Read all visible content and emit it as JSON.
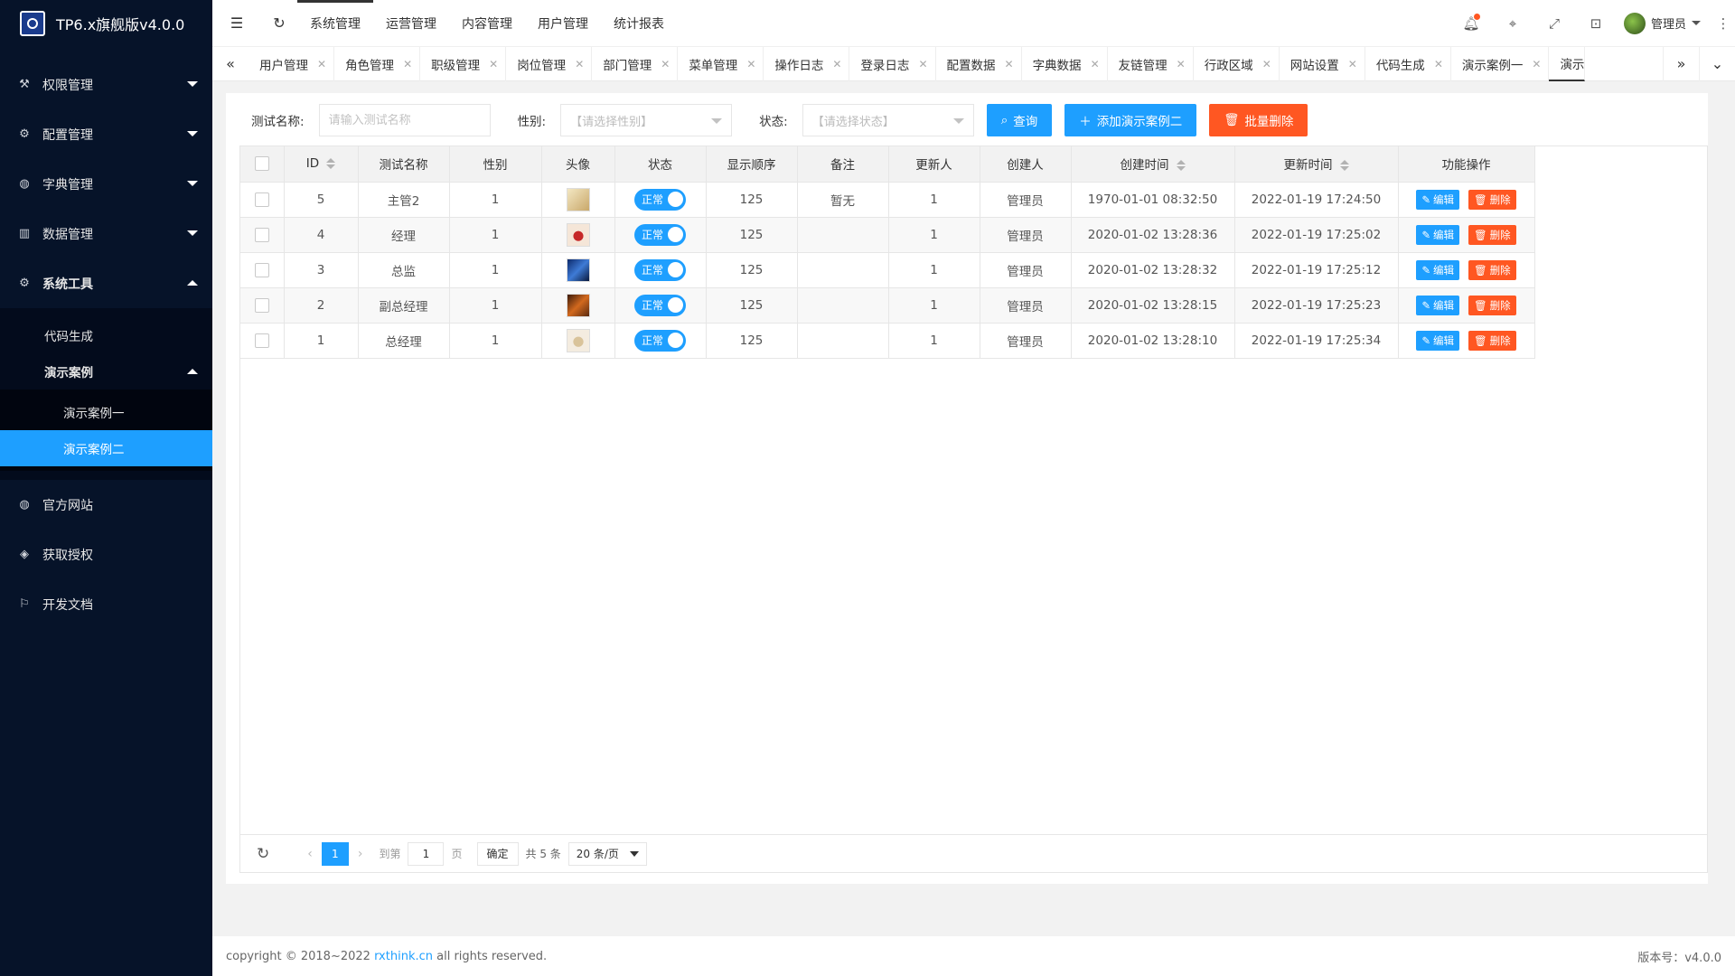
{
  "app": {
    "title": "TP6.x旗舰版v4.0.0"
  },
  "sidebar": {
    "items": [
      {
        "label": "权限管理",
        "icon": "users-icon"
      },
      {
        "label": "配置管理",
        "icon": "gear-icon"
      },
      {
        "label": "字典管理",
        "icon": "globe-icon"
      },
      {
        "label": "数据管理",
        "icon": "book-icon"
      },
      {
        "label": "系统工具",
        "icon": "gear-icon"
      }
    ],
    "sub": [
      {
        "label": "代码生成"
      },
      {
        "label": "演示案例"
      }
    ],
    "subsub": [
      {
        "label": "演示案例一"
      },
      {
        "label": "演示案例二"
      }
    ],
    "bottom": [
      {
        "label": "官方网站",
        "icon": "globe-icon"
      },
      {
        "label": "获取授权",
        "icon": "diamond-icon"
      },
      {
        "label": "开发文档",
        "icon": "flag-icon"
      }
    ]
  },
  "topnav": [
    "系统管理",
    "运营管理",
    "内容管理",
    "用户管理",
    "统计报表"
  ],
  "header": {
    "user": "管理员"
  },
  "tabs": [
    "用户管理",
    "角色管理",
    "职级管理",
    "岗位管理",
    "部门管理",
    "菜单管理",
    "操作日志",
    "登录日志",
    "配置数据",
    "字典数据",
    "友链管理",
    "行政区域",
    "网站设置",
    "代码生成",
    "演示案例一",
    "演示"
  ],
  "search": {
    "name_label": "测试名称:",
    "name_placeholder": "请输入测试名称",
    "gender_label": "性别:",
    "gender_placeholder": "【请选择性别】",
    "status_label": "状态:",
    "status_placeholder": "【请选择状态】",
    "query_btn": "查询",
    "add_btn": "添加演示案例二",
    "batch_delete_btn": "批量删除"
  },
  "table": {
    "headers": [
      "ID",
      "测试名称",
      "性别",
      "头像",
      "状态",
      "显示顺序",
      "备注",
      "更新人",
      "创建人",
      "创建时间",
      "更新时间",
      "功能操作"
    ],
    "rows": [
      {
        "id": "5",
        "name": "主管2",
        "gender": "1",
        "status": "正常",
        "order": "125",
        "remark": "暂无",
        "updater": "1",
        "creator": "管理员",
        "created": "1970-01-01 08:32:50",
        "updated": "2022-01-19 17:24:50"
      },
      {
        "id": "4",
        "name": "经理",
        "gender": "1",
        "status": "正常",
        "order": "125",
        "remark": "",
        "updater": "1",
        "creator": "管理员",
        "created": "2020-01-02 13:28:36",
        "updated": "2022-01-19 17:25:02"
      },
      {
        "id": "3",
        "name": "总监",
        "gender": "1",
        "status": "正常",
        "order": "125",
        "remark": "",
        "updater": "1",
        "creator": "管理员",
        "created": "2020-01-02 13:28:32",
        "updated": "2022-01-19 17:25:12"
      },
      {
        "id": "2",
        "name": "副总经理",
        "gender": "1",
        "status": "正常",
        "order": "125",
        "remark": "",
        "updater": "1",
        "creator": "管理员",
        "created": "2020-01-02 13:28:15",
        "updated": "2022-01-19 17:25:23"
      },
      {
        "id": "1",
        "name": "总经理",
        "gender": "1",
        "status": "正常",
        "order": "125",
        "remark": "",
        "updater": "1",
        "creator": "管理员",
        "created": "2020-01-02 13:28:10",
        "updated": "2022-01-19 17:25:34"
      }
    ],
    "edit_label": "编辑",
    "delete_label": "删除"
  },
  "pager": {
    "current": "1",
    "goto_label": "到第",
    "goto_value": "1",
    "page_label": "页",
    "confirm": "确定",
    "total": "共 5 条",
    "page_size": "20 条/页"
  },
  "footer": {
    "copyright_pre": "copyright © 2018~2022 ",
    "link": "rxthink.cn",
    "copyright_post": " all rights reserved.",
    "version": "版本号：v4.0.0"
  }
}
